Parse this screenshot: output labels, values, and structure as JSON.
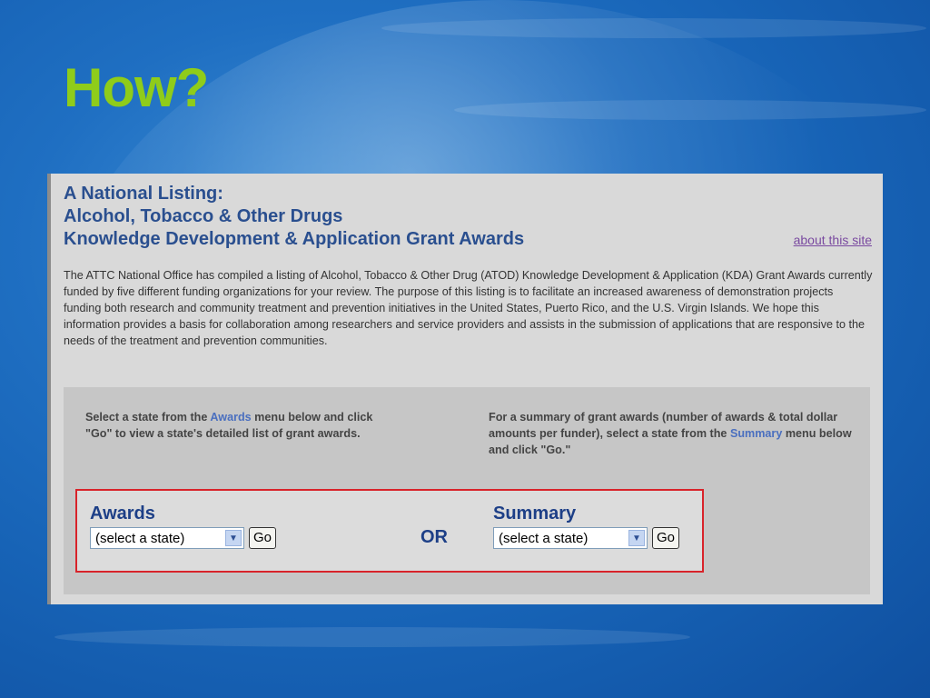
{
  "slide": {
    "title": "How?"
  },
  "panel": {
    "heading": [
      "A National Listing:",
      "Alcohol, Tobacco & Other Drugs",
      "Knowledge Development & Application Grant Awards"
    ],
    "about_link": "about this site",
    "intro": "The ATTC National Office has compiled a listing of Alcohol, Tobacco & Other Drug (ATOD) Knowledge Development & Application (KDA) Grant Awards currently funded by five different funding organizations for your review. The purpose of this listing is to facilitate an increased awareness of demonstration projects funding both research and community treatment and prevention initiatives in the United States, Puerto Rico, and the U.S. Virgin Islands. We hope this information provides a basis for collaboration among researchers and service providers and assists in the submission of applications that are responsive to the needs of the treatment and prevention communities.",
    "left_instructions": {
      "before": "Select a state from the ",
      "highlight": "Awards",
      "after": " menu below and click \"Go\" to view a state's detailed list of grant awards."
    },
    "right_instructions": {
      "before": "For a summary of grant awards (number of awards & total dollar amounts per funder), select a state from the ",
      "highlight": "Summary",
      "after": " menu below and click \"Go.\""
    },
    "awards": {
      "label": "Awards",
      "selected": "(select a state)",
      "go": "Go"
    },
    "or_label": "OR",
    "summary": {
      "label": "Summary",
      "selected": "(select a state)",
      "go": "Go"
    }
  },
  "colors": {
    "title_green": "#8fcc1a",
    "heading_blue": "#2a4f8f",
    "box_red": "#d8232a"
  }
}
